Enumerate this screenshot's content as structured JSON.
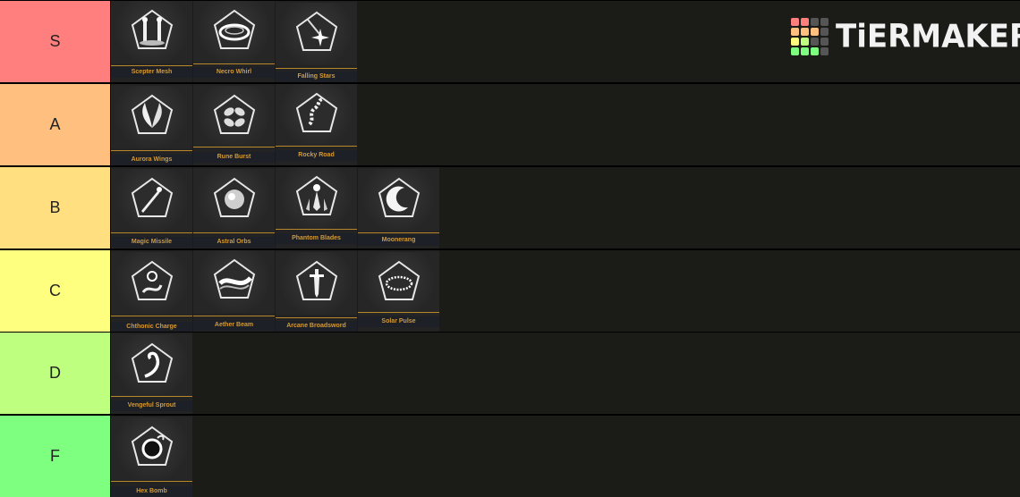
{
  "logo": {
    "text": "TiERMAKER",
    "grid_colors": [
      "#ff7f7f",
      "#ff7f7f",
      "#555555",
      "#555555",
      "#ffbf7f",
      "#ffbf7f",
      "#ffbf7f",
      "#555555",
      "#ffff7f",
      "#bfff7f",
      "#555555",
      "#555555",
      "#7fff7f",
      "#7fff7f",
      "#7fff7f",
      "#555555"
    ]
  },
  "tiers": [
    {
      "label": "S",
      "color": "#ff7f7f",
      "items": [
        {
          "name": "Scepter Mesh",
          "icon": "twin-scepters-icon"
        },
        {
          "name": "Necro Whirl",
          "icon": "whirl-ring-icon"
        },
        {
          "name": "Falling Stars",
          "icon": "falling-star-icon"
        }
      ]
    },
    {
      "label": "A",
      "color": "#ffbf7f",
      "items": [
        {
          "name": "Aurora Wings",
          "icon": "wings-icon"
        },
        {
          "name": "Rune Burst",
          "icon": "rune-petals-icon"
        },
        {
          "name": "Rocky Road",
          "icon": "rocky-trail-icon"
        }
      ]
    },
    {
      "label": "B",
      "color": "#ffdf7f",
      "items": [
        {
          "name": "Magic Missile",
          "icon": "missile-icon"
        },
        {
          "name": "Astral Orbs",
          "icon": "orb-icon"
        },
        {
          "name": "Phantom Blades",
          "icon": "phantom-blades-icon"
        },
        {
          "name": "Moonerang",
          "icon": "crescent-moon-icon"
        }
      ]
    },
    {
      "label": "C",
      "color": "#ffff7f",
      "items": [
        {
          "name": "Chthonic Charge",
          "icon": "serpent-orb-icon"
        },
        {
          "name": "Aether Beam",
          "icon": "beam-icon"
        },
        {
          "name": "Arcane Broadsword",
          "icon": "broadsword-icon"
        },
        {
          "name": "Solar Pulse",
          "icon": "pulse-ring-icon"
        }
      ]
    },
    {
      "label": "D",
      "color": "#bfff7f",
      "items": [
        {
          "name": "Vengeful Sprout",
          "icon": "sprout-icon"
        }
      ]
    },
    {
      "label": "F",
      "color": "#7fff7f",
      "items": [
        {
          "name": "Hex Bomb",
          "icon": "bomb-icon"
        }
      ]
    }
  ]
}
